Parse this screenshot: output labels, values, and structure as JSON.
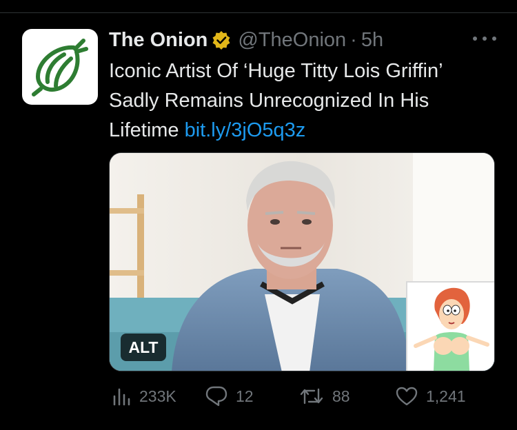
{
  "tweet": {
    "author": {
      "display_name": "The Onion",
      "handle": "@TheOnion",
      "verified": true,
      "avatar_icon": "onion-logo-icon"
    },
    "separator": "·",
    "time": "5h",
    "text_lines": [
      "Iconic Artist Of ‘Huge Titty Lois Griffin’",
      "Sadly Remains Unrecognized In His",
      "Lifetime "
    ],
    "link": "bit.ly/3jO5q3z",
    "media": {
      "alt_badge": "ALT",
      "description_icon": "photo-man-with-cartoon-inset"
    },
    "metrics": {
      "views": "233K",
      "replies": "12",
      "retweets": "88",
      "likes": "1,241"
    }
  },
  "colors": {
    "background": "#000000",
    "text_primary": "#e7e9ea",
    "text_secondary": "#71767b",
    "link": "#1d9bf0",
    "onion_green": "#2e7d32",
    "verified_gold": "#e2b719"
  }
}
